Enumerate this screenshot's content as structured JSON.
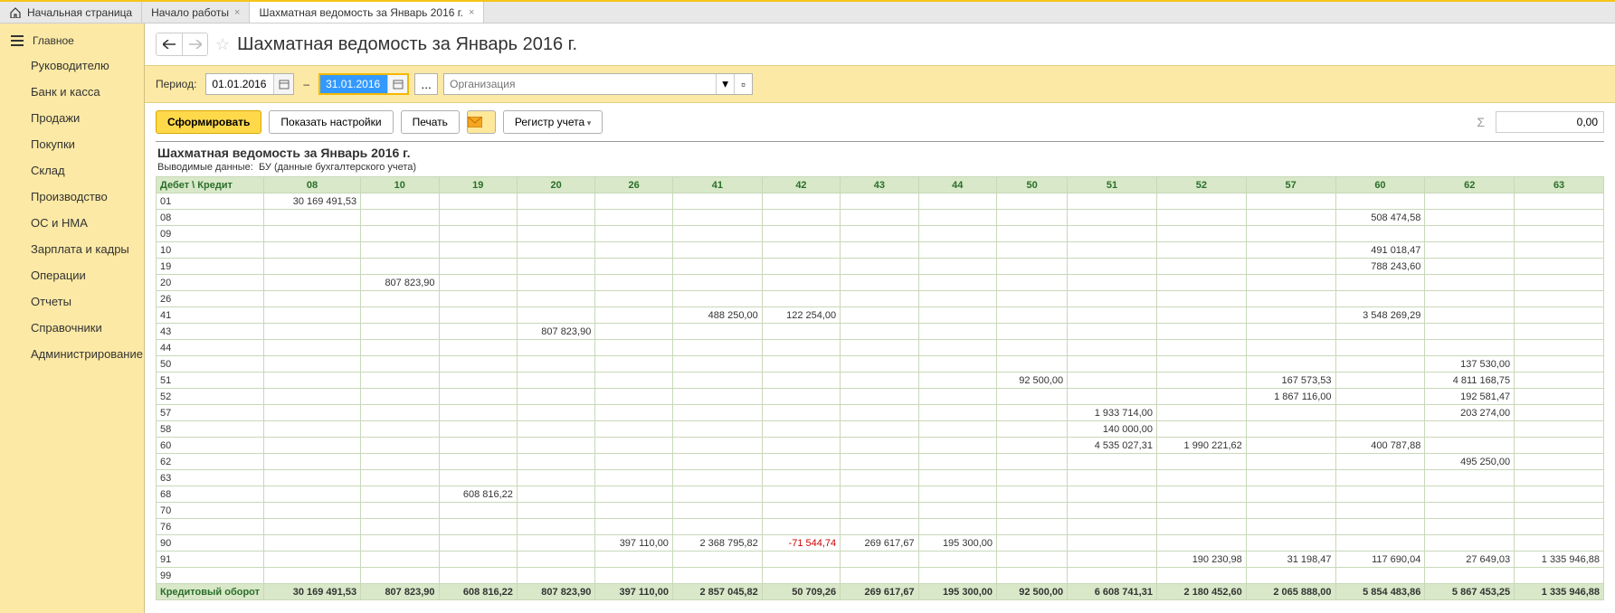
{
  "tabs": [
    {
      "label": "Начальная страница",
      "home": true,
      "closable": false
    },
    {
      "label": "Начало работы",
      "closable": true
    },
    {
      "label": "Шахматная ведомость за Январь 2016 г.",
      "closable": true,
      "active": true
    }
  ],
  "sidebar": {
    "first": "Главное",
    "items": [
      "Руководителю",
      "Банк и касса",
      "Продажи",
      "Покупки",
      "Склад",
      "Производство",
      "ОС и НМА",
      "Зарплата и кадры",
      "Операции",
      "Отчеты",
      "Справочники",
      "Администрирование"
    ]
  },
  "title": "Шахматная ведомость за Январь 2016 г.",
  "period": {
    "label": "Период:",
    "from": "01.01.2016",
    "to": "31.01.2016",
    "org_placeholder": "Организация"
  },
  "actions": {
    "form": "Сформировать",
    "show_settings": "Показать настройки",
    "print": "Печать",
    "register": "Регистр учета",
    "total": "0,00"
  },
  "report": {
    "title": "Шахматная ведомость за Январь 2016 г.",
    "sub_label": "Выводимые данные:",
    "sub_value": "БУ (данные бухгалтерского учета)",
    "corner": "Дебет \\ Кредит",
    "cols": [
      "08",
      "10",
      "19",
      "20",
      "26",
      "41",
      "42",
      "43",
      "44",
      "50",
      "51",
      "52",
      "57",
      "60",
      "62",
      "63"
    ],
    "rows": [
      {
        "h": "01",
        "c": {
          "08": "30 169 491,53"
        }
      },
      {
        "h": "08",
        "c": {
          "60": "508 474,58"
        }
      },
      {
        "h": "09",
        "c": {}
      },
      {
        "h": "10",
        "c": {
          "60": "491 018,47"
        }
      },
      {
        "h": "19",
        "c": {
          "60": "788 243,60"
        }
      },
      {
        "h": "20",
        "c": {
          "10": "807 823,90"
        }
      },
      {
        "h": "26",
        "c": {}
      },
      {
        "h": "41",
        "c": {
          "41": "488 250,00",
          "42": "122 254,00",
          "60": "3 548 269,29"
        }
      },
      {
        "h": "43",
        "c": {
          "20": "807 823,90"
        }
      },
      {
        "h": "44",
        "c": {}
      },
      {
        "h": "50",
        "c": {
          "62": "137 530,00"
        }
      },
      {
        "h": "51",
        "c": {
          "50": "92 500,00",
          "57": "167 573,53",
          "62": "4 811 168,75"
        }
      },
      {
        "h": "52",
        "c": {
          "57": "1 867 116,00",
          "62": "192 581,47"
        }
      },
      {
        "h": "57",
        "c": {
          "51": "1 933 714,00",
          "62": "203 274,00"
        }
      },
      {
        "h": "58",
        "c": {
          "51": "140 000,00"
        }
      },
      {
        "h": "60",
        "c": {
          "51": "4 535 027,31",
          "52": "1 990 221,62",
          "60": "400 787,88"
        }
      },
      {
        "h": "62",
        "c": {
          "62": "495 250,00"
        }
      },
      {
        "h": "63",
        "c": {}
      },
      {
        "h": "68",
        "c": {
          "19": "608 816,22"
        }
      },
      {
        "h": "70",
        "c": {}
      },
      {
        "h": "76",
        "c": {}
      },
      {
        "h": "90",
        "c": {
          "26": "397 110,00",
          "41": "2 368 795,82",
          "42": "-71 544,74",
          "43": "269 617,67",
          "44": "195 300,00"
        }
      },
      {
        "h": "91",
        "c": {
          "52": "190 230,98",
          "57": "31 198,47",
          "60": "117 690,04",
          "62": "27 649,03",
          "63": "1 335 946,88"
        }
      },
      {
        "h": "99",
        "c": {}
      }
    ],
    "total_label": "Кредитовый оборот",
    "totals": {
      "08": "30 169 491,53",
      "10": "807 823,90",
      "19": "608 816,22",
      "20": "807 823,90",
      "26": "397 110,00",
      "41": "2 857 045,82",
      "42": "50 709,26",
      "43": "269 617,67",
      "44": "195 300,00",
      "50": "92 500,00",
      "51": "6 608 741,31",
      "52": "2 180 452,60",
      "57": "2 065 888,00",
      "60": "5 854 483,86",
      "62": "5 867 453,25",
      "63": "1 335 946,88"
    }
  }
}
